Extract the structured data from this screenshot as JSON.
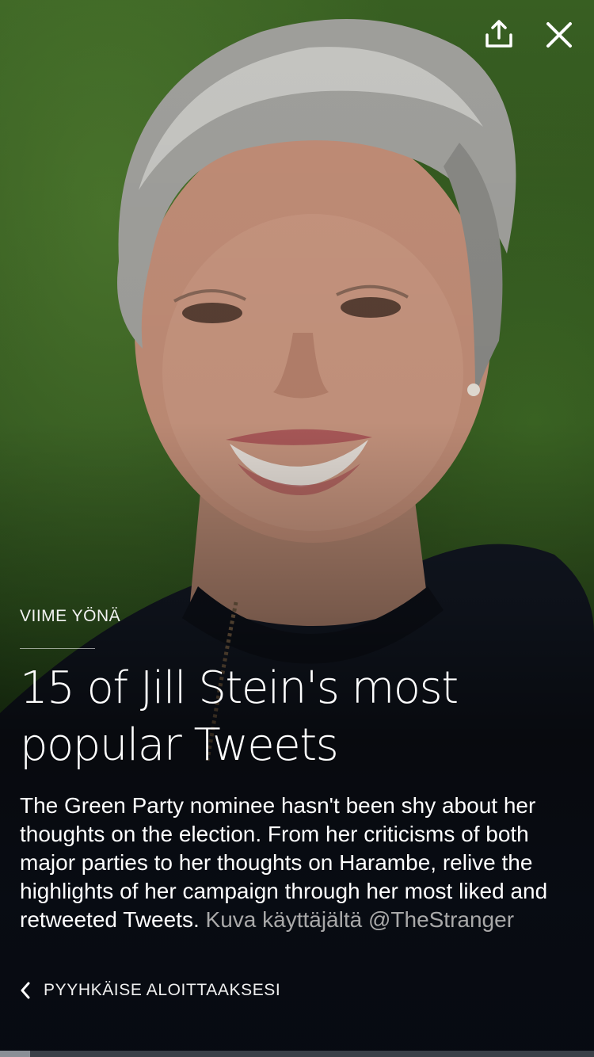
{
  "topbar": {
    "share_icon": "share-icon",
    "close_icon": "close-icon"
  },
  "story": {
    "kicker": "VIIME YÖNÄ",
    "headline": "15 of Jill Stein's most popular Tweets",
    "summary": "The Green Party nominee hasn't been shy about her thoughts on the election. From her criticisms of both major parties to her thoughts on Harambe, relive the highlights of her campaign through her most liked and retweeted Tweets.",
    "credit": "Kuva käyttäjältä @TheStranger"
  },
  "swipe": {
    "label": "PYYHKÄISE ALOITTAAKSESI",
    "icon": "chevron-left-icon"
  },
  "progress": {
    "fraction": 0.05
  },
  "colors": {
    "credit": "#a9a9a9",
    "background_green": "#3b6424",
    "overlay_dark": "#05080e"
  }
}
